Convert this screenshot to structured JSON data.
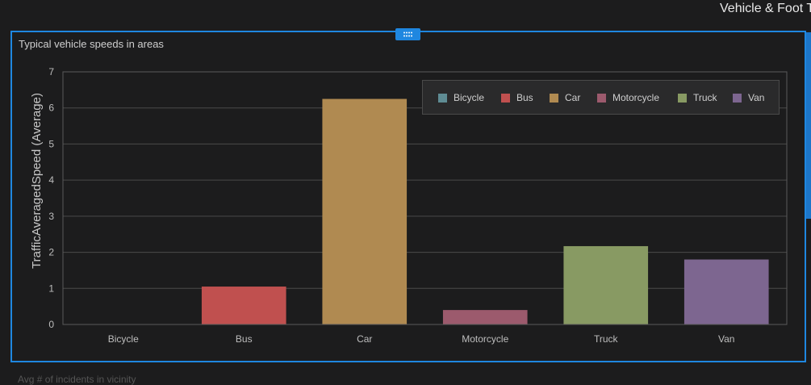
{
  "header": {
    "title": "Vehicle & Foot T"
  },
  "panel": {
    "title": "Typical vehicle speeds in areas",
    "drag_icon": "grip-dots-icon"
  },
  "footer": {
    "next_panel_title": "Avg # of incidents in vicinity"
  },
  "chart_data": {
    "type": "bar",
    "title": "Typical vehicle speeds in areas",
    "xlabel": "",
    "ylabel": "TrafficAveragedSpeed (Average)",
    "categories": [
      "Bicycle",
      "Bus",
      "Car",
      "Motorcycle",
      "Truck",
      "Van"
    ],
    "values": [
      0,
      1.05,
      6.25,
      0.4,
      2.17,
      1.8
    ],
    "colors": [
      "#5f8c94",
      "#c0504f",
      "#b08a51",
      "#9c5a6d",
      "#889a63",
      "#7d6690"
    ],
    "ylim": [
      0,
      7
    ],
    "yticks": [
      0,
      1,
      2,
      3,
      4,
      5,
      6,
      7
    ],
    "grid": true,
    "legend": {
      "position": "top-right",
      "entries": [
        "Bicycle",
        "Bus",
        "Car",
        "Motorcycle",
        "Truck",
        "Van"
      ]
    }
  }
}
